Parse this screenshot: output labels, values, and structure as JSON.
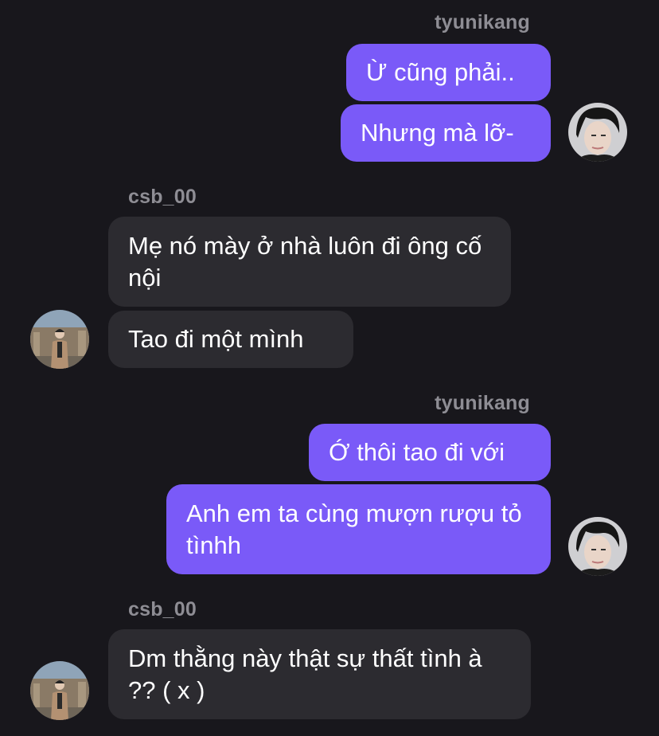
{
  "conversation": {
    "groups": [
      {
        "sender": "tyunikang",
        "messages": [
          "Ừ cũng phải..",
          "Nhưng mà lỡ-"
        ]
      },
      {
        "sender": "csb_00",
        "messages": [
          "Mẹ nó mày ở nhà luôn đi ông cố nội",
          "Tao đi một mình"
        ]
      },
      {
        "sender": "tyunikang",
        "messages": [
          "Ớ thôi tao đi với",
          "Anh em ta cùng mượn rượu tỏ tìnhh"
        ]
      },
      {
        "sender": "csb_00",
        "messages": [
          "Dm thằng này thật sự thất tình à ?? ( x )"
        ]
      }
    ]
  },
  "colors": {
    "background": "#18171c",
    "outgoing_bubble": "#7a5af8",
    "incoming_bubble": "#2c2b30",
    "sender_name": "#8e8d94",
    "message_text": "#ffffff"
  }
}
